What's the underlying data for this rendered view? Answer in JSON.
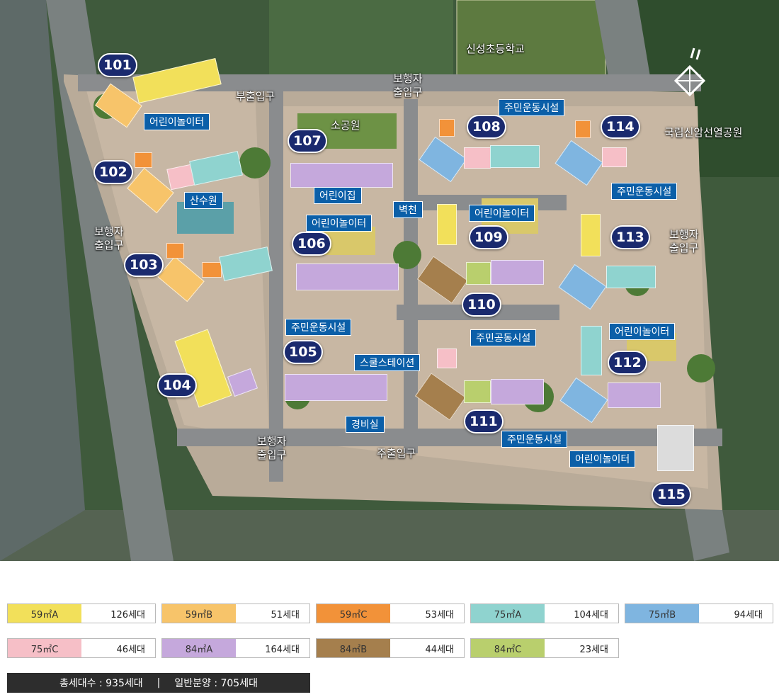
{
  "buildings": [
    "101",
    "102",
    "103",
    "104",
    "105",
    "106",
    "107",
    "108",
    "109",
    "110",
    "111",
    "112",
    "113",
    "114",
    "115"
  ],
  "facilities": {
    "playground": "어린이놀이터",
    "fitness": "주민운동시설",
    "daycare": "어린이집",
    "community": "주민공동시설",
    "school_station": "스쿨스테이션",
    "guard": "경비실",
    "wall": "벽천",
    "garden": "산수원"
  },
  "map_labels": {
    "sub_entrance": "부출입구",
    "main_entrance": "주출입구",
    "ped_entrance": "보행자\n출입구",
    "small_park": "소공원",
    "school": "신성초등학교",
    "park": "국립신암선열공원"
  },
  "colors": {
    "59A": "#f2e05a",
    "59B": "#f7c46a",
    "59C": "#f29239",
    "75A": "#8fd3cf",
    "75B": "#7fb5e0",
    "75C": "#f6bfc7",
    "84A": "#c5a8dc",
    "84B": "#a57f4d",
    "84C": "#b9cf6d"
  },
  "legend": [
    {
      "type": "59㎡A",
      "count": "126세대",
      "color": "#f2e05a"
    },
    {
      "type": "59㎡B",
      "count": "51세대",
      "color": "#f7c46a"
    },
    {
      "type": "59㎡C",
      "count": "53세대",
      "color": "#f29239"
    },
    {
      "type": "75㎡A",
      "count": "104세대",
      "color": "#8fd3cf"
    },
    {
      "type": "75㎡B",
      "count": "94세대",
      "color": "#7fb5e0"
    },
    {
      "type": "75㎡C",
      "count": "46세대",
      "color": "#f6bfc7"
    },
    {
      "type": "84㎡A",
      "count": "164세대",
      "color": "#c5a8dc"
    },
    {
      "type": "84㎡B",
      "count": "44세대",
      "color": "#a57f4d"
    },
    {
      "type": "84㎡C",
      "count": "23세대",
      "color": "#b9cf6d"
    }
  ],
  "summary": {
    "total": "총세대수 : 935세대",
    "separator": "|",
    "general": "일반분양 : 705세대"
  }
}
